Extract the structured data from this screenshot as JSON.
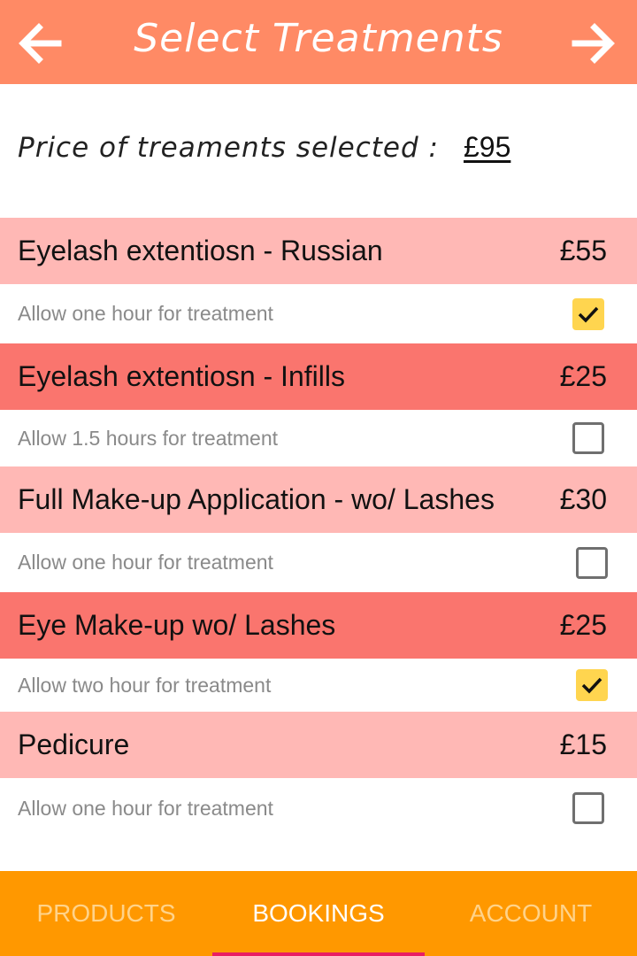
{
  "header": {
    "title": "Select Treatments",
    "back_icon": "arrow-left-icon",
    "forward_icon": "arrow-right-icon",
    "color": "#FF8A65"
  },
  "price": {
    "label": "Price of treaments selected :",
    "value": "£95"
  },
  "treatments": [
    {
      "name": "Eyelash extentiosn - Russian",
      "price": "£55",
      "note": "Allow one hour for treatment",
      "checked": true
    },
    {
      "name": "Eyelash extentiosn - Infills",
      "price": "£25",
      "note": "Allow 1.5 hours for treatment",
      "checked": false
    },
    {
      "name": "Full Make-up Application - wo/ Lashes",
      "price": "£30",
      "note": "Allow one hour for treatment",
      "checked": false
    },
    {
      "name": "Eye Make-up wo/ Lashes",
      "price": "£25",
      "note": "Allow two hour for treatment",
      "checked": true
    },
    {
      "name": "Pedicure",
      "price": "£15",
      "note": "Allow one hour for treatment",
      "checked": false
    }
  ],
  "tabs": [
    {
      "label": "PRODUCTS",
      "active": false
    },
    {
      "label": "BOOKINGS",
      "active": true
    },
    {
      "label": "ACCOUNT",
      "active": false
    }
  ],
  "colors": {
    "row_light": "#FFB8B5",
    "row_dark": "#FA756E",
    "checkbox_checked": "#FFD54F",
    "tabbar": "#FF9800",
    "tab_indicator": "#E91E63"
  }
}
